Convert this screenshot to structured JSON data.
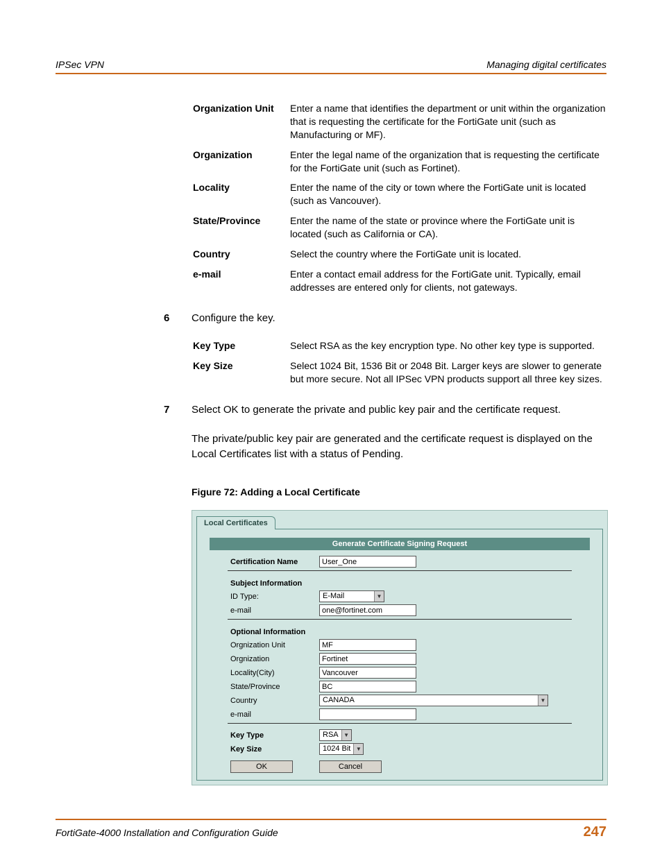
{
  "header": {
    "left": "IPSec VPN",
    "right": "Managing digital certificates"
  },
  "defs1": [
    {
      "label": "Organization Unit",
      "desc": "Enter a name that identifies the department or unit within the organization that is requesting the certificate for the FortiGate unit (such as Manufacturing or MF)."
    },
    {
      "label": "Organization",
      "desc": "Enter the legal name of the organization that is requesting the certificate for the FortiGate unit (such as Fortinet)."
    },
    {
      "label": "Locality",
      "desc": "Enter the name of the city or town where the FortiGate unit is located (such as Vancouver)."
    },
    {
      "label": "State/Province",
      "desc": "Enter the name of the state or province where the FortiGate unit is located (such as California or CA)."
    },
    {
      "label": "Country",
      "desc": "Select the country where the FortiGate unit is located."
    },
    {
      "label": "e-mail",
      "desc": "Enter a contact email address for the FortiGate unit. Typically, email addresses are entered only for clients, not gateways."
    }
  ],
  "step6": {
    "num": "6",
    "text": "Configure the key."
  },
  "defs2": [
    {
      "label": "Key Type",
      "desc": "Select RSA as the key encryption type. No other key type is supported."
    },
    {
      "label": "Key Size",
      "desc": "Select 1024 Bit, 1536 Bit or 2048 Bit. Larger keys are slower to generate but more secure. Not all IPSec VPN products support all three key sizes."
    }
  ],
  "step7": {
    "num": "7",
    "text": "Select OK to generate the private and public key pair and the certificate request.",
    "extra": "The private/public key pair are generated and the certificate request is displayed on the Local Certificates list with a status of Pending."
  },
  "figure_caption": "Figure 72: Adding a Local Certificate",
  "figure": {
    "tab": "Local Certificates",
    "panel_title": "Generate Certificate Signing Request",
    "cert_name_label": "Certification Name",
    "cert_name_value": "User_One",
    "subject_header": "Subject Information",
    "id_type_label": "ID Type:",
    "id_type_value": "E-Mail",
    "email_label": "e-mail",
    "email_value": "one@fortinet.com",
    "optional_header": "Optional Information",
    "org_unit_label": "Orgnization Unit",
    "org_unit_value": "MF",
    "org_label": "Orgnization",
    "org_value": "Fortinet",
    "locality_label": "Locality(City)",
    "locality_value": "Vancouver",
    "state_label": "State/Province",
    "state_value": "BC",
    "country_label": "Country",
    "country_value": "CANADA",
    "opt_email_label": "e-mail",
    "opt_email_value": "",
    "key_type_label": "Key Type",
    "key_type_value": "RSA",
    "key_size_label": "Key Size",
    "key_size_value": "1024 Bit",
    "ok": "OK",
    "cancel": "Cancel"
  },
  "footer": {
    "text": "FortiGate-4000 Installation and Configuration Guide",
    "page": "247"
  }
}
